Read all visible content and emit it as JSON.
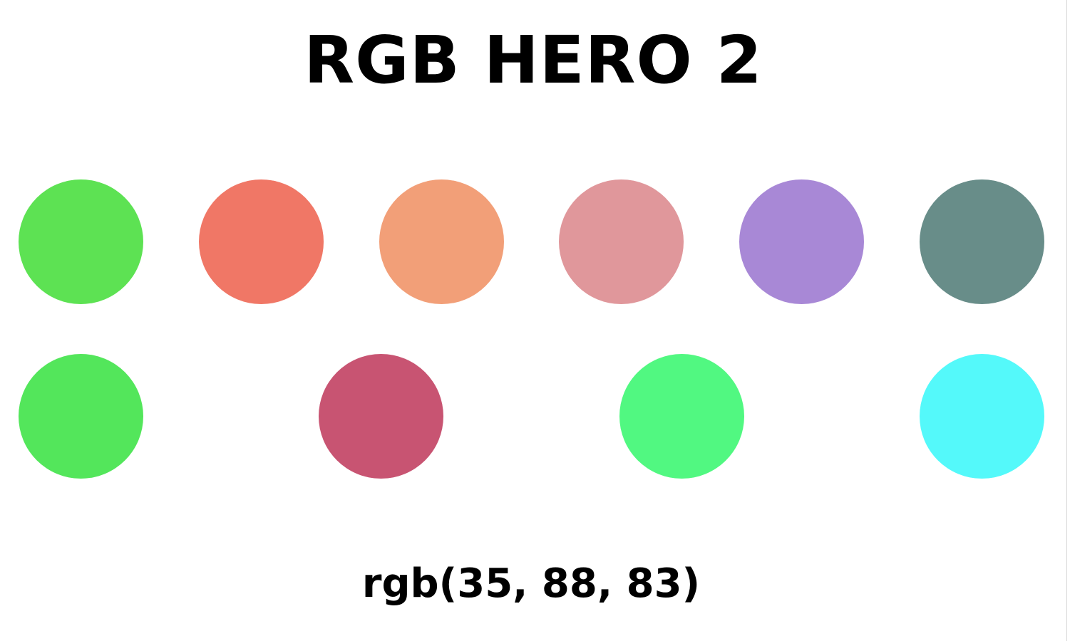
{
  "title": "RGB HERO 2",
  "target_color_text": "rgb(35, 88, 83)",
  "circles": {
    "row1": [
      {
        "color": "#5de253"
      },
      {
        "color": "#f07766"
      },
      {
        "color": "#f29f78"
      },
      {
        "color": "#e0979b"
      },
      {
        "color": "#a888d6"
      },
      {
        "color": "#688d89"
      }
    ],
    "row2": [
      {
        "color": "#53e65b"
      },
      {
        "color": "#c85472"
      },
      {
        "color": "#51f881"
      },
      {
        "color": "#54f9fa"
      }
    ]
  }
}
